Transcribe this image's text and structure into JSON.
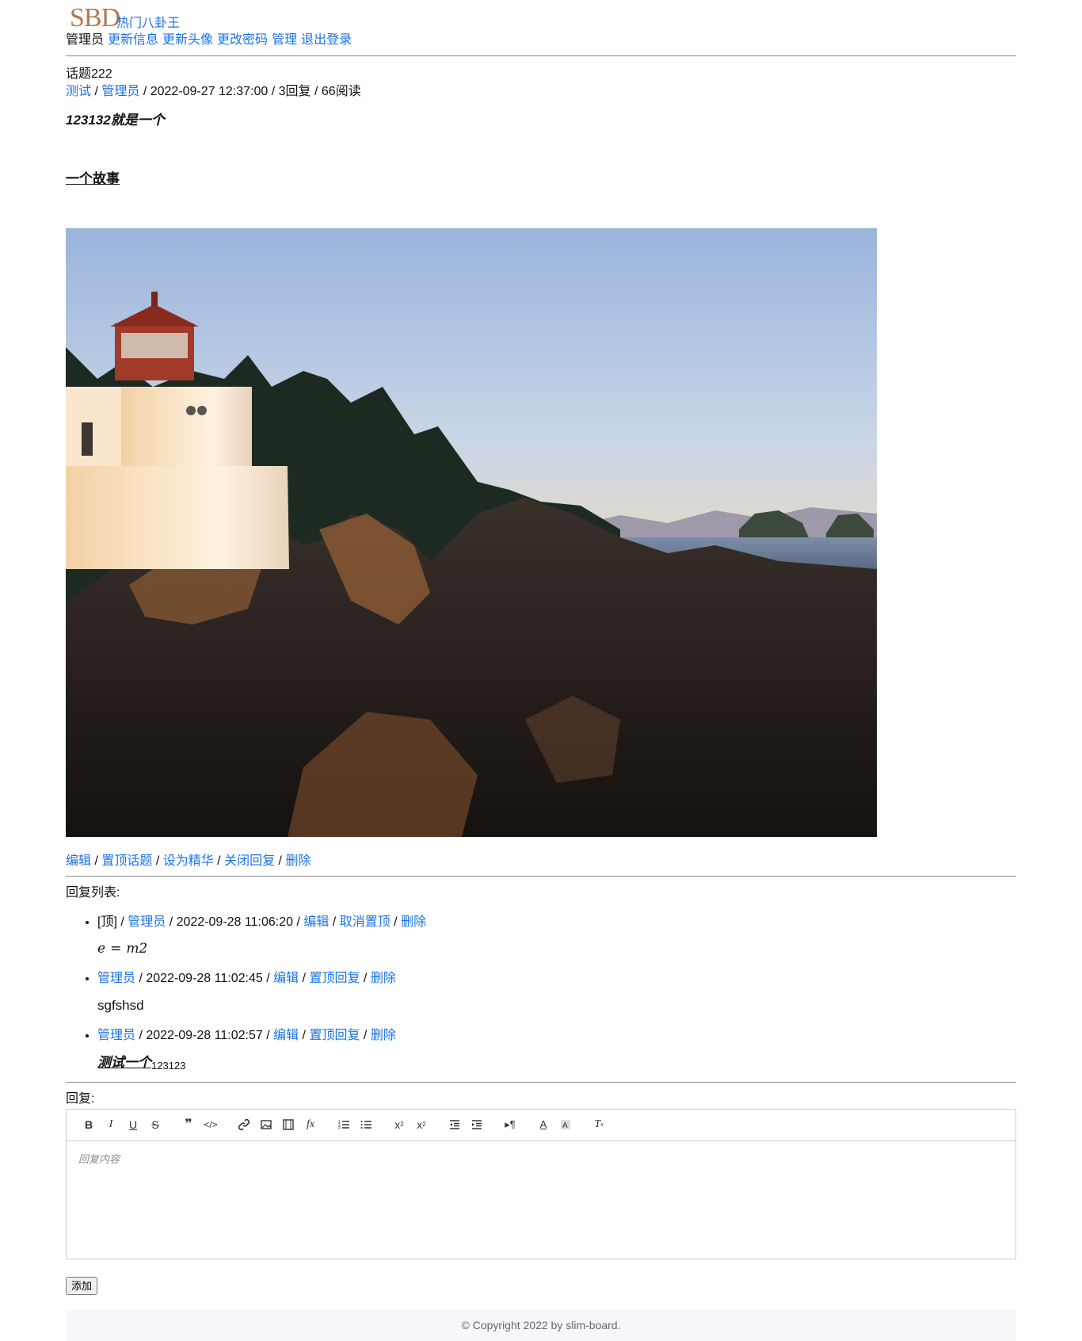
{
  "header": {
    "logo": "SBD",
    "site_title": "热门八卦王",
    "user_name": "管理员",
    "nav": [
      "更新信息",
      "更新头像",
      "更改密码",
      "管理",
      "退出登录"
    ]
  },
  "topic": {
    "title": "话题222",
    "category": "测试",
    "author": "管理员",
    "datetime": "2022-09-27 12:37:00",
    "replies": "3回复",
    "reads": "66阅读",
    "content_line1": "123132就是一个",
    "content_line2": "一个故事",
    "image_alt": "lighthouse on rocky coast at sunset",
    "actions": [
      "编辑",
      "置顶话题",
      "设为精华",
      "关闭回复",
      "删除"
    ]
  },
  "reply_list": {
    "title": "回复列表:",
    "items": [
      {
        "pinned_tag": "[顶]",
        "author": "管理员",
        "datetime": "2022-09-28 11:06:20",
        "actions": [
          "编辑",
          "取消置顶",
          "删除"
        ],
        "body_math_left": "e",
        "body_math_op": "=",
        "body_math_right": "m2"
      },
      {
        "author": "管理员",
        "datetime": "2022-09-28 11:02:45",
        "actions": [
          "编辑",
          "置顶回复",
          "删除"
        ],
        "body": "sgfshsd"
      },
      {
        "author": "管理员",
        "datetime": "2022-09-28 11:02:57",
        "actions": [
          "编辑",
          "置顶回复",
          "删除"
        ],
        "body_strong": "测试一个",
        "body_sub": "123123"
      }
    ]
  },
  "reply_form": {
    "label": "回复:",
    "placeholder": "回复内容",
    "submit": "添加"
  },
  "footer": {
    "copyright": "© Copyright 2022 by slim-board."
  },
  "colors": {
    "link": "#1a73e8",
    "logo": "#b07a4f",
    "rule": "#8a8a8a"
  },
  "toolbar_icons": [
    "bold-icon",
    "italic-icon",
    "underline-icon",
    "strike-icon",
    "blockquote-icon",
    "code-block-icon",
    "link-icon",
    "image-icon",
    "video-icon",
    "formula-icon",
    "ordered-list-icon",
    "bullet-list-icon",
    "subscript-icon",
    "superscript-icon",
    "outdent-icon",
    "indent-icon",
    "direction-icon",
    "text-color-icon",
    "background-color-icon",
    "clear-format-icon"
  ]
}
